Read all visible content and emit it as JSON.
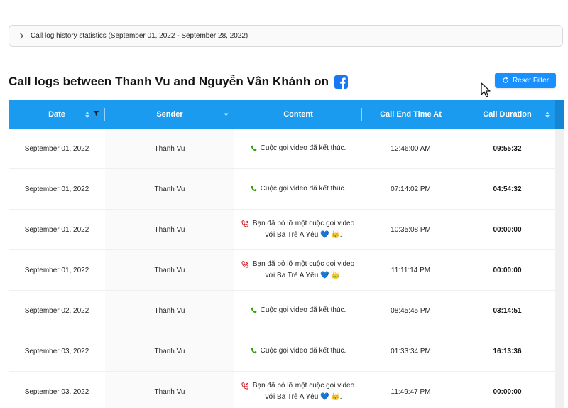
{
  "stats_panel": {
    "title": "Call log history statistics (September 01, 2022 - September 28, 2022)"
  },
  "page_title": "Call logs between Thanh Vu and Nguyễn Vân Khánh on",
  "platform_icon": "facebook-icon",
  "reset_button": {
    "label": "Reset Filter",
    "icon": "reload-icon"
  },
  "colors": {
    "header_bg": "#1a9bef",
    "accent": "#1890ff",
    "facebook": "#1877f2",
    "answered_call": "#389e0d",
    "missed_call": "#cf1322"
  },
  "table": {
    "columns": [
      {
        "label": "Date",
        "sortable": true,
        "filtered": true
      },
      {
        "label": "Sender",
        "sortable": false,
        "filter_dropdown": true
      },
      {
        "label": "Content"
      },
      {
        "label": "Call End Time At"
      },
      {
        "label": "Call Duration",
        "sortable": true
      }
    ],
    "rows": [
      {
        "date": "September 01, 2022",
        "sender": "Thanh Vu",
        "call_icon": "phone-icon",
        "content": "Cuộc gọi video đã kết thúc.",
        "end_time": "12:46:00 AM",
        "duration": "09:55:32"
      },
      {
        "date": "September 01, 2022",
        "sender": "Thanh Vu",
        "call_icon": "phone-icon",
        "content": "Cuộc gọi video đã kết thúc.",
        "end_time": "07:14:02 PM",
        "duration": "04:54:32"
      },
      {
        "date": "September 01, 2022",
        "sender": "Thanh Vu",
        "call_icon": "missed-call-icon",
        "content": "Bạn đã bỏ lỡ một cuộc gọi video với Ba Trẻ A Yêu 💙 👑.",
        "end_time": "10:35:08 PM",
        "duration": "00:00:00"
      },
      {
        "date": "September 01, 2022",
        "sender": "Thanh Vu",
        "call_icon": "missed-call-icon",
        "content": "Bạn đã bỏ lỡ một cuộc gọi video với Ba Trẻ A Yêu 💙 👑.",
        "end_time": "11:11:14 PM",
        "duration": "00:00:00"
      },
      {
        "date": "September 02, 2022",
        "sender": "Thanh Vu",
        "call_icon": "phone-icon",
        "content": "Cuộc gọi video đã kết thúc.",
        "end_time": "08:45:45 PM",
        "duration": "03:14:51"
      },
      {
        "date": "September 03, 2022",
        "sender": "Thanh Vu",
        "call_icon": "phone-icon",
        "content": "Cuộc gọi video đã kết thúc.",
        "end_time": "01:33:34 PM",
        "duration": "16:13:36"
      },
      {
        "date": "September 03, 2022",
        "sender": "Thanh Vu",
        "call_icon": "missed-call-icon",
        "content": "Bạn đã bỏ lỡ một cuộc gọi video với Ba Trẻ A Yêu 💙 👑.",
        "end_time": "11:49:47 PM",
        "duration": "00:00:00"
      }
    ]
  }
}
